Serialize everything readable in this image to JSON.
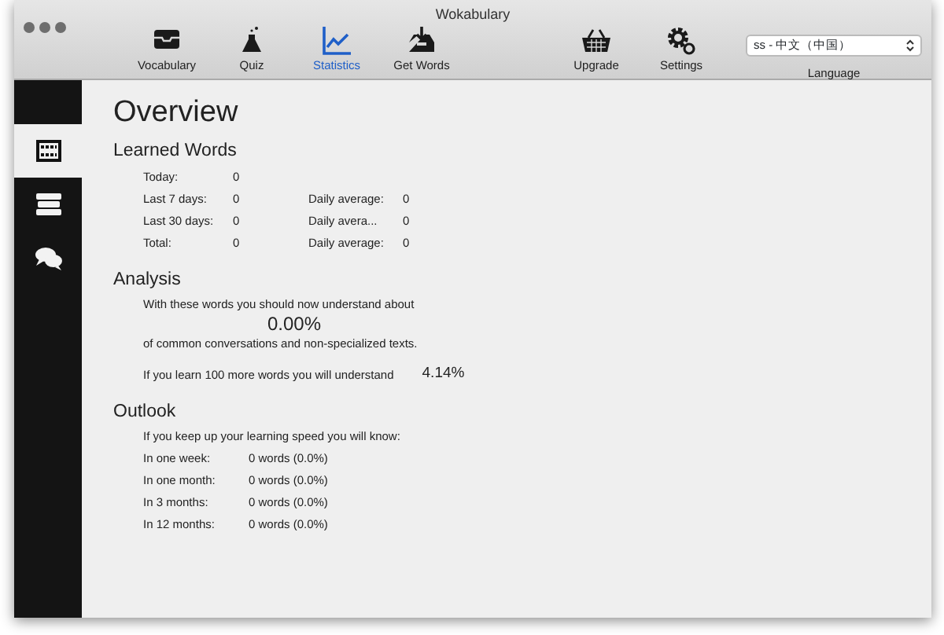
{
  "window": {
    "title": "Wokabulary"
  },
  "toolbar": {
    "items": [
      {
        "label": "Vocabulary",
        "selected": false
      },
      {
        "label": "Quiz",
        "selected": false
      },
      {
        "label": "Statistics",
        "selected": true
      },
      {
        "label": "Get Words",
        "selected": false
      },
      {
        "label": "Upgrade",
        "selected": false
      },
      {
        "label": "Settings",
        "selected": false
      }
    ],
    "language": {
      "value": "ss - 中文（中国）",
      "label": "Language"
    }
  },
  "sidebar": {
    "items": [
      {
        "selected": true
      },
      {
        "selected": false
      },
      {
        "selected": false
      }
    ]
  },
  "overview": {
    "title": "Overview",
    "learned_words": {
      "heading": "Learned Words",
      "rows": [
        {
          "label": "Today:",
          "value": "0"
        },
        {
          "label": "Last 7 days:",
          "value": "0",
          "average_label": "Daily average:",
          "average_value": "0"
        },
        {
          "label": "Last 30 days:",
          "value": "0",
          "average_label": "Daily avera...",
          "average_value": "0"
        },
        {
          "label": "Total:",
          "value": "0",
          "average_label": "Daily average:",
          "average_value": "0"
        }
      ]
    },
    "analysis": {
      "heading": "Analysis",
      "intro": "With these words you should now understand about",
      "percent": "0.00%",
      "note": "of common conversations and non-specialized texts.",
      "projection": "If you learn 100 more words you will understand",
      "projection_value": "4.14%"
    },
    "outlook": {
      "heading": "Outlook",
      "intro": "If you keep up your learning speed you will know:",
      "rows": [
        {
          "label": "In one week:",
          "value": "0 words (0.0%)"
        },
        {
          "label": "In one month:",
          "value": "0 words (0.0%)"
        },
        {
          "label": "In 3 months:",
          "value": "0 words (0.0%)"
        },
        {
          "label": "In 12 months:",
          "value": "0 words (0.0%)"
        }
      ]
    }
  }
}
